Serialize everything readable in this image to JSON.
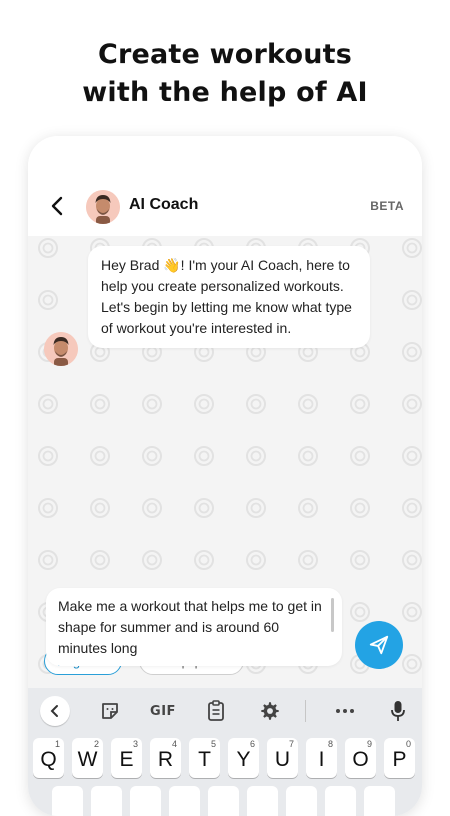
{
  "headline": {
    "line1": "Create workouts",
    "line2": "with the help of AI"
  },
  "header": {
    "coach_name": "AI Coach",
    "badge": "BETA"
  },
  "chat": {
    "message": "Hey Brad 👋! I'm your AI Coach, here to help you create personalized workouts. Let's begin by letting me know what type of workout you're interested in."
  },
  "chips": [
    {
      "label": "Beginner",
      "selected": true
    },
    {
      "label": "All equipment",
      "selected": false
    }
  ],
  "input": {
    "value": "Make me a workout that helps me to get in shape for summer and is around 60 minutes long"
  },
  "keyboard": {
    "toolbar": {
      "gif_label": "GIF",
      "icons": [
        "chevron-left-icon",
        "sticker-icon",
        "gif-icon",
        "clipboard-icon",
        "gear-icon",
        "more-icon",
        "microphone-icon"
      ]
    },
    "keys": [
      {
        "letter": "Q",
        "num": "1"
      },
      {
        "letter": "W",
        "num": "2"
      },
      {
        "letter": "E",
        "num": "3"
      },
      {
        "letter": "R",
        "num": "4"
      },
      {
        "letter": "T",
        "num": "5"
      },
      {
        "letter": "Y",
        "num": "6"
      },
      {
        "letter": "U",
        "num": "7"
      },
      {
        "letter": "I",
        "num": "8"
      },
      {
        "letter": "O",
        "num": "9"
      },
      {
        "letter": "P",
        "num": "0"
      }
    ]
  },
  "colors": {
    "accent": "#23a3e4",
    "chat_bg": "#f4f4f4",
    "keyboard_bg": "#e8eaed"
  }
}
